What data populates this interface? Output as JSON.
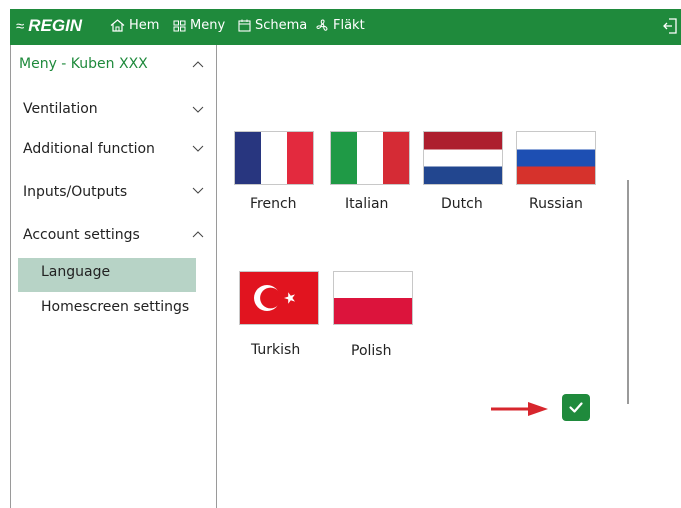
{
  "topbar": {
    "logo": "REGIN",
    "nav": [
      {
        "label": "Hem",
        "icon": "home-icon"
      },
      {
        "label": "Meny",
        "icon": "grid-icon"
      },
      {
        "label": "Schema",
        "icon": "calendar-icon"
      },
      {
        "label": "Fläkt",
        "icon": "fan-icon"
      }
    ],
    "logout_icon": "logout-icon",
    "color": "#1f8a3c"
  },
  "sidebar": {
    "title": "Meny - Kuben XXX",
    "items": [
      {
        "label": "Ventilation",
        "expanded": false
      },
      {
        "label": "Additional function",
        "expanded": false
      },
      {
        "label": "Inputs/Outputs",
        "expanded": false
      },
      {
        "label": "Account settings",
        "expanded": true
      }
    ],
    "subitems": [
      {
        "label": "Language",
        "selected": true
      },
      {
        "label": "Homescreen settings",
        "selected": false
      }
    ],
    "highlight_color": "#b7d3c6"
  },
  "languages": [
    {
      "label": "French",
      "icon": "flag-france-icon"
    },
    {
      "label": "Italian",
      "icon": "flag-italy-icon"
    },
    {
      "label": "Dutch",
      "icon": "flag-netherlands-icon"
    },
    {
      "label": "Russian",
      "icon": "flag-russia-icon"
    },
    {
      "label": "Turkish",
      "icon": "flag-turkey-icon"
    },
    {
      "label": "Polish",
      "icon": "flag-poland-icon"
    }
  ],
  "confirm": {
    "icon": "check-icon",
    "arrow_color": "#d7262d"
  }
}
